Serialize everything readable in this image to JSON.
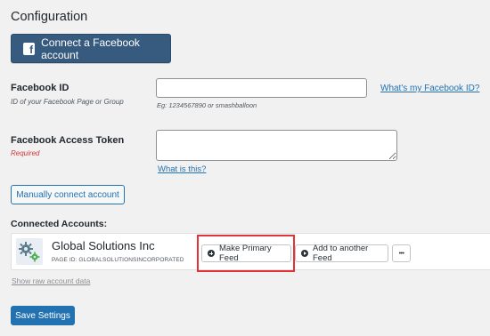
{
  "config": {
    "title": "Configuration",
    "connect_button": "Connect a Facebook account",
    "facebook_icon_glyph": "f"
  },
  "facebook_id": {
    "label": "Facebook ID",
    "description": "ID of your Facebook Page or Group",
    "value": "",
    "hint": "Eg: 1234567890 or smashballoon",
    "help_link": "What's my Facebook ID?"
  },
  "access_token": {
    "label": "Facebook Access Token",
    "required": "Required",
    "value": "",
    "help_link": "What is this?"
  },
  "manual_connect_button": "Manually connect account",
  "connected_accounts": {
    "heading": "Connected Accounts:",
    "accounts": [
      {
        "name": "Global Solutions Inc",
        "page_id": "PAGE ID: GLOBALSOLUTIONSINCORPORATED",
        "avatar_icon": "gears-icon",
        "make_primary_label": "Make Primary Feed",
        "add_feed_label": "Add to another Feed",
        "more_label": "•••"
      }
    ],
    "highlight_color": "#e2333b"
  },
  "raw_data_link": "Show raw account data",
  "save_button": "Save Settings",
  "colors": {
    "facebook_blue": "#375a7f",
    "wp_blue": "#2271b1",
    "required_red": "#d63638"
  }
}
